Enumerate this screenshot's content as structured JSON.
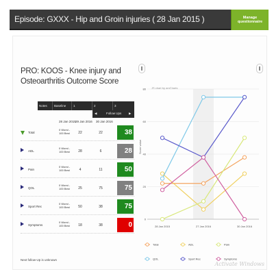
{
  "header": {
    "title": "Episode: GXXX - Hip and Groin injuries ( 28 Jan 2015 )",
    "manage_label": "Manage questionnaire"
  },
  "pro": {
    "title": "PRO: KOOS - Knee injury and Osteoarthritis Outcome Score"
  },
  "table": {
    "headers": [
      "Notes",
      "Baseline",
      "1",
      "2",
      "3"
    ],
    "follow_up_label": "Follow Ups",
    "dates": [
      "28 Jan 2015",
      "29 Jan 2016",
      "30 Jan 2016"
    ],
    "rows": [
      {
        "label": "Total",
        "range": "0 Worst - 100 Best",
        "baseline": "22",
        "fu1": "22",
        "score": "38",
        "color": "#1f8a1f",
        "trend": "down-green"
      },
      {
        "label": "ADL",
        "range": "0 Worst - 100 Best",
        "baseline": "28",
        "fu1": "6",
        "score": "28",
        "color": "#808080",
        "trend": "right"
      },
      {
        "label": "Pain",
        "range": "0 Worst - 100 Best",
        "baseline": "4",
        "fu1": "11",
        "score": "50",
        "color": "#1f8a1f",
        "trend": "right"
      },
      {
        "label": "QOL",
        "range": "0 Worst - 100 Best",
        "baseline": "25",
        "fu1": "75",
        "score": "75",
        "color": "#808080",
        "trend": "right"
      },
      {
        "label": "Sport Rec",
        "range": "0 Worst - 100 Best",
        "baseline": "50",
        "fu1": "38",
        "score": "75",
        "color": "#1f8a1f",
        "trend": "right"
      },
      {
        "label": "Symptoms",
        "range": "0 Worst - 100 Best",
        "baseline": "18",
        "fu1": "38",
        "score": "0",
        "color": "#e00000",
        "trend": "right"
      }
    ],
    "footnote": "Next follow-Up is unknown"
  },
  "chart_data": {
    "type": "line",
    "title": "JS chart by amCharts",
    "ylabel": "Score value",
    "x": [
      "28 Jan 2015",
      "27 Jan 2016",
      "30 Jan 2016"
    ],
    "ylim": [
      0,
      80
    ],
    "yticks": [
      0,
      20,
      40,
      60,
      80
    ],
    "grid": true,
    "legend_position": "bottom",
    "series": [
      {
        "name": "Total",
        "values": [
          22,
          22,
          38
        ],
        "color": "#f4a460"
      },
      {
        "name": "ADL",
        "values": [
          28,
          6,
          28
        ],
        "color": "#f0d060"
      },
      {
        "name": "Pain",
        "values": [
          0,
          11,
          50
        ],
        "color": "#d8e87a"
      },
      {
        "name": "QOL",
        "values": [
          25,
          75,
          75
        ],
        "color": "#7ec8e8"
      },
      {
        "name": "Sport Rec",
        "values": [
          50,
          38,
          75
        ],
        "color": "#5a5acb"
      },
      {
        "name": "Symptoms",
        "values": [
          18,
          38,
          0
        ],
        "color": "#d060a0"
      }
    ]
  },
  "watermark": "Activate Windows"
}
